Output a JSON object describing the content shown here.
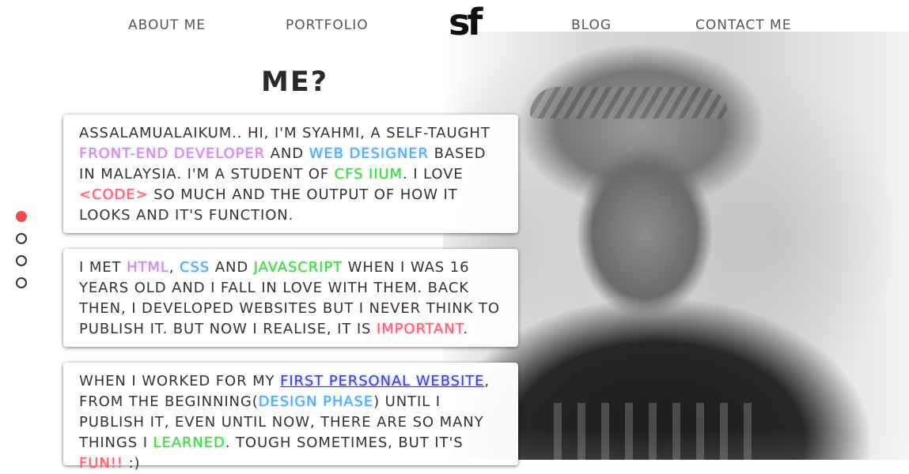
{
  "nav": {
    "about": "ABOUT ME",
    "portfolio": "PORTFOLIO",
    "logo": "sf",
    "blog": "BLOG",
    "contact": "CONTACT ME"
  },
  "title": "ME?",
  "colors": {
    "accent_red": "#f24b4b",
    "purple": "#c98be0",
    "blue": "#4aa7f0",
    "green": "#43d24a",
    "pink": "#ff5a6e",
    "link": "#3b3bd6"
  },
  "pagination": {
    "count": 4,
    "active_index": 0
  },
  "cards": [
    {
      "segments": [
        {
          "t": "Assalamualaikum.. Hi, I'm Syahmi, a self-taught "
        },
        {
          "t": "Front-End Developer",
          "c": "purple"
        },
        {
          "t": " and "
        },
        {
          "t": "Web Designer",
          "c": "blue"
        },
        {
          "t": " based in Malaysia. I'm a student of "
        },
        {
          "t": "CFS IIUM",
          "c": "green"
        },
        {
          "t": ". I love "
        },
        {
          "t": "<code>",
          "c": "red"
        },
        {
          "t": " so much and the output of how it looks and it's function."
        }
      ]
    },
    {
      "segments": [
        {
          "t": "I met "
        },
        {
          "t": "HTML",
          "c": "purple"
        },
        {
          "t": ", "
        },
        {
          "t": "CSS",
          "c": "blue"
        },
        {
          "t": " and "
        },
        {
          "t": "Javascript",
          "c": "green"
        },
        {
          "t": " when I was 16 years old and I fall in love with them. Back then, I developed websites but I never think to publish it. But now I realise, it is "
        },
        {
          "t": "important",
          "c": "red"
        },
        {
          "t": "."
        }
      ]
    },
    {
      "segments": [
        {
          "t": "When I worked for my "
        },
        {
          "t": "first personal website",
          "c": "link"
        },
        {
          "t": ", from the beginning("
        },
        {
          "t": "design phase",
          "c": "blue"
        },
        {
          "t": ") until I publish it, even until now, there are so many things I "
        },
        {
          "t": "learned",
          "c": "green"
        },
        {
          "t": ". Tough sometimes, but it's "
        },
        {
          "t": "fun!!",
          "c": "red"
        },
        {
          "t": " :)"
        }
      ]
    }
  ]
}
